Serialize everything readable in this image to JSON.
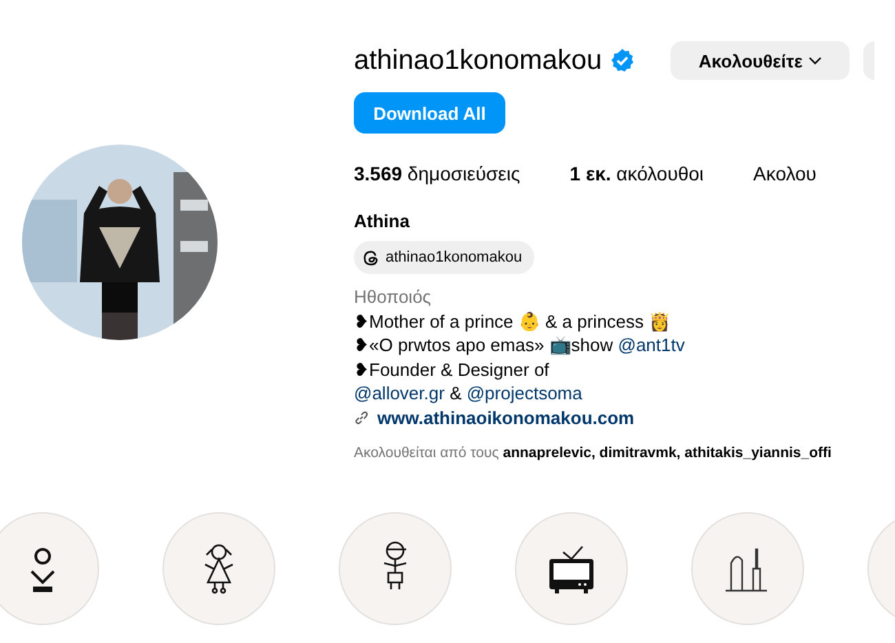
{
  "profile": {
    "username": "athinao1konomakou",
    "verified": true,
    "follow_button": "Ακολουθείτε",
    "download_button": "Download All",
    "stats": [
      "**3.569** δημοσιεύσεις",
      "**1 εκ.** ακόλουθοι",
      "Ακολου"
    ],
    "name": "Athina",
    "threads_handle": "athinao1konomakou",
    "category": "Ηθοποιός",
    "bio_lines": [
      [
        {
          "kind": "text",
          "text": "❥Mother of a prince 👶 & a princess 👸"
        }
      ],
      [
        {
          "kind": "text",
          "text": "❥«O prwtos apo emas» 📺show "
        },
        {
          "kind": "link",
          "text": "@ant1tv"
        }
      ],
      [
        {
          "kind": "text",
          "text": "❥Founder & Designer of"
        }
      ],
      [
        {
          "kind": "link",
          "text": "@allover.gr"
        },
        {
          "kind": "text",
          "text": " & "
        },
        {
          "kind": "link",
          "text": "@projectsoma"
        }
      ]
    ],
    "website": "www.athinaoikonomakou.com",
    "followed_by": "Ακολουθείται από τους **annaprelevic, dimitravmk, athitakis_yiannis_offi**"
  },
  "highlights": [
    {
      "kind": "logo"
    },
    {
      "kind": "girl"
    },
    {
      "kind": "boy"
    },
    {
      "kind": "tv"
    },
    {
      "kind": "skyline"
    },
    {
      "kind": "blank"
    }
  ]
}
